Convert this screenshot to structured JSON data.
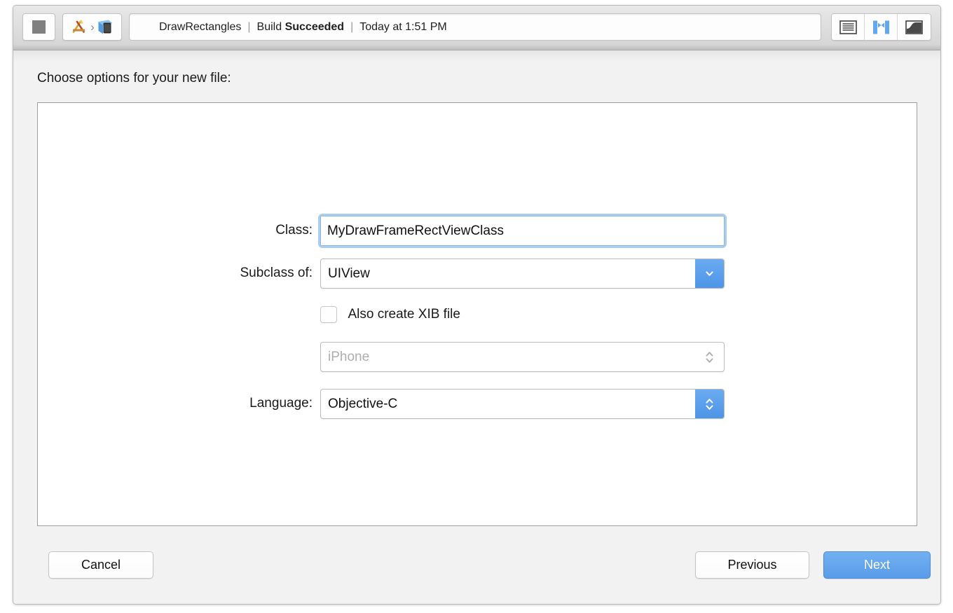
{
  "toolbar": {
    "stop_button": "stop-button",
    "scheme_icon": "xcode-app-icon",
    "scheme_separator": "›",
    "destination_icon": "ios-simulator-icon",
    "status": {
      "project": "DrawRectangles",
      "separator": "|",
      "build_prefix": "Build",
      "build_result": "Succeeded",
      "timestamp": "Today at 1:51 PM"
    },
    "editor_buttons": [
      {
        "name": "standard-editor-button",
        "label": "Standard Editor",
        "active": false
      },
      {
        "name": "assistant-editor-button",
        "label": "Assistant Editor",
        "active": true
      },
      {
        "name": "version-editor-button",
        "label": "Version Editor",
        "active": false
      }
    ]
  },
  "sheet": {
    "heading": "Choose options for your new file:",
    "fields": {
      "class": {
        "label": "Class:",
        "value": "MyDrawFrameRectViewClass",
        "placeholder": "",
        "focused": true
      },
      "subclass": {
        "label": "Subclass of:",
        "value": "UIView",
        "icon": "chevron-down-icon",
        "enabled": true
      },
      "xib": {
        "label": "Also create XIB file",
        "checked": false
      },
      "device": {
        "label": "",
        "value": "iPhone",
        "icon": "chevron-up-down-icon",
        "enabled": false
      },
      "language": {
        "label": "Language:",
        "value": "Objective-C",
        "icon": "chevron-up-down-icon",
        "enabled": true
      }
    },
    "buttons": {
      "cancel": "Cancel",
      "previous": "Previous",
      "next": "Next"
    }
  },
  "colors": {
    "accent_blue": "#5a9ce9",
    "focus_ring": "#a9cef0",
    "window_background": "#f2f2f2",
    "panel_background": "#ffffff"
  }
}
